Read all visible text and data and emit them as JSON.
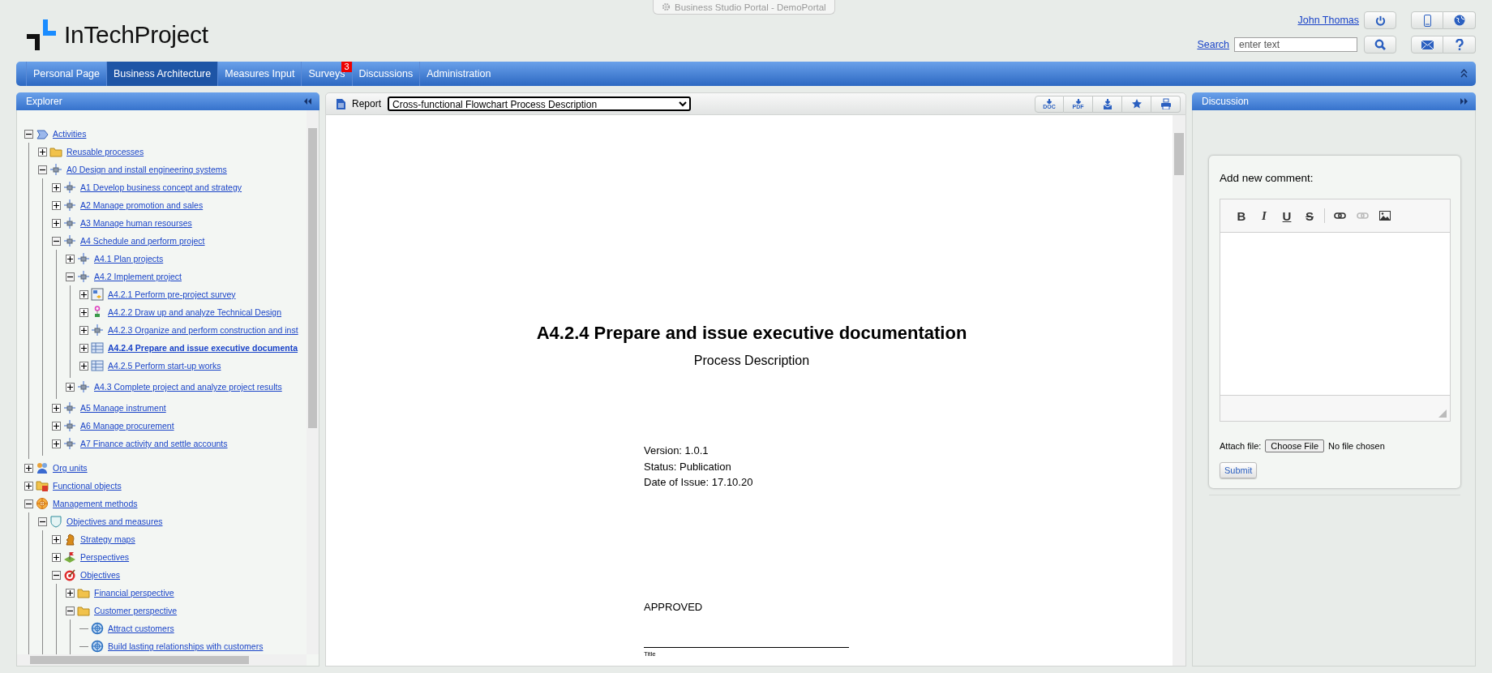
{
  "window": {
    "title": "Business Studio Portal - DemoPortal"
  },
  "header": {
    "logo_text": "InTechProject",
    "user_name": "John Thomas",
    "search": {
      "label": "Search",
      "placeholder": "enter text"
    }
  },
  "nav": {
    "tabs": [
      {
        "label": "Personal Page",
        "selected": false
      },
      {
        "label": "Business Architecture",
        "selected": true
      },
      {
        "label": "Measures Input",
        "selected": false
      },
      {
        "label": "Surveys",
        "selected": false,
        "badge": "3"
      },
      {
        "label": "Discussions",
        "selected": false
      },
      {
        "label": "Administration",
        "selected": false
      }
    ]
  },
  "explorer": {
    "title": "Explorer",
    "tree": [
      {
        "label": "Activities",
        "kind": "activities",
        "expandable": true,
        "expanded": true,
        "selected": false,
        "children": [
          {
            "label": "Reusable processes",
            "kind": "folder",
            "expandable": true,
            "expanded": false,
            "selected": false
          },
          {
            "label": "A0 Design and install engineering systems",
            "kind": "process",
            "expandable": true,
            "expanded": true,
            "selected": false,
            "children": [
              {
                "label": "A1 Develop business concept and strategy",
                "kind": "process",
                "expandable": true,
                "expanded": false,
                "selected": false
              },
              {
                "label": "A2 Manage promotion and sales",
                "kind": "process",
                "expandable": true,
                "expanded": false,
                "selected": false
              },
              {
                "label": "A3 Manage human resourses",
                "kind": "process",
                "expandable": true,
                "expanded": false,
                "selected": false
              },
              {
                "label": "A4 Schedule and perform project",
                "kind": "process",
                "expandable": true,
                "expanded": true,
                "selected": false,
                "children": [
                  {
                    "label": "A4.1 Plan projects",
                    "kind": "process",
                    "expandable": true,
                    "expanded": false,
                    "selected": false
                  },
                  {
                    "label": "A4.2 Implement project",
                    "kind": "process",
                    "expandable": true,
                    "expanded": true,
                    "selected": false,
                    "children": [
                      {
                        "label": "A4.2.1 Perform pre-project survey",
                        "kind": "diagram",
                        "expandable": true,
                        "expanded": false,
                        "selected": false
                      },
                      {
                        "label": "A4.2.2 Draw up and analyze Technical Design",
                        "kind": "flow",
                        "expandable": true,
                        "expanded": false,
                        "selected": false
                      },
                      {
                        "label": "A4.2.3 Organize and perform construction and inst",
                        "kind": "process",
                        "expandable": true,
                        "expanded": false,
                        "selected": false
                      },
                      {
                        "label": "A4.2.4 Prepare and issue executive documenta",
                        "kind": "table",
                        "expandable": true,
                        "expanded": false,
                        "selected": true
                      },
                      {
                        "label": "A4.2.5 Perform start-up works",
                        "kind": "table",
                        "expandable": true,
                        "expanded": false,
                        "selected": false
                      }
                    ]
                  },
                  {
                    "label": "A4.3 Complete project and analyze project results",
                    "kind": "process",
                    "expandable": true,
                    "expanded": false,
                    "selected": false
                  }
                ]
              },
              {
                "label": "A5 Manage instrument",
                "kind": "process",
                "expandable": true,
                "expanded": false,
                "selected": false
              },
              {
                "label": "A6 Manage procurement",
                "kind": "process",
                "expandable": true,
                "expanded": false,
                "selected": false
              },
              {
                "label": "A7 Finance activity and settle accounts",
                "kind": "process",
                "expandable": true,
                "expanded": false,
                "selected": false
              }
            ]
          }
        ]
      },
      {
        "label": "Org units",
        "kind": "org",
        "expandable": true,
        "expanded": false,
        "selected": false
      },
      {
        "label": "Functional objects",
        "kind": "functional",
        "expandable": true,
        "expanded": false,
        "selected": false
      },
      {
        "label": "Management methods",
        "kind": "methods",
        "expandable": true,
        "expanded": true,
        "selected": false,
        "children": [
          {
            "label": "Objectives and measures",
            "kind": "bsc",
            "expandable": true,
            "expanded": true,
            "selected": false,
            "children": [
              {
                "label": "Strategy maps",
                "kind": "strategy",
                "expandable": true,
                "expanded": false,
                "selected": false
              },
              {
                "label": "Perspectives",
                "kind": "perspectives",
                "expandable": true,
                "expanded": false,
                "selected": false
              },
              {
                "label": "Objectives",
                "kind": "objectives",
                "expandable": true,
                "expanded": true,
                "selected": false,
                "children": [
                  {
                    "label": "Financial perspective",
                    "kind": "folder",
                    "expandable": true,
                    "expanded": false,
                    "selected": false
                  },
                  {
                    "label": "Customer perspective",
                    "kind": "folder",
                    "expandable": true,
                    "expanded": true,
                    "selected": false,
                    "children": [
                      {
                        "label": "Attract customers",
                        "kind": "goal",
                        "expandable": false,
                        "selected": false
                      },
                      {
                        "label": "Build lasting relationships with customers",
                        "kind": "goal",
                        "expandable": false,
                        "selected": false
                      }
                    ]
                  }
                ]
              }
            ]
          }
        ]
      }
    ]
  },
  "report": {
    "label": "Report",
    "selected_report": "Cross-functional Flowchart Process Description",
    "export_buttons": [
      {
        "kind": "doc",
        "label": "DOC"
      },
      {
        "kind": "pdf",
        "label": "PDF"
      },
      {
        "kind": "mail"
      },
      {
        "kind": "star"
      },
      {
        "kind": "print"
      }
    ],
    "document": {
      "title": "A4.2.4 Prepare and issue executive documentation",
      "subtitle": "Process Description",
      "details": [
        "Version: 1.0.1",
        "Status: Publication",
        "Date of Issue: 17.10.20"
      ],
      "approval": "APPROVED",
      "signature_caption": "Title"
    }
  },
  "discussion": {
    "title": "Discussion",
    "form": {
      "heading": "Add new comment:",
      "editor_buttons": [
        {
          "kind": "bold",
          "label": "B",
          "disabled": false
        },
        {
          "kind": "italic",
          "label": "I",
          "disabled": false
        },
        {
          "kind": "underline",
          "label": "U",
          "disabled": false
        },
        {
          "kind": "strike",
          "label": "S",
          "disabled": false
        },
        {
          "kind": "link",
          "disabled": false
        },
        {
          "kind": "unlink",
          "disabled": true
        },
        {
          "kind": "image",
          "disabled": false
        }
      ],
      "attach_label": "Attach file:",
      "file_button": "Choose File",
      "file_status": "No file chosen",
      "submit": "Submit"
    }
  }
}
